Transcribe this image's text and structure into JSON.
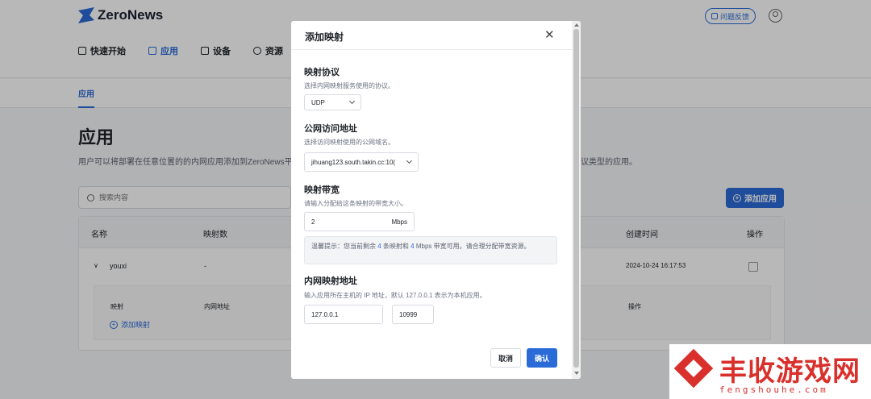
{
  "app": {
    "logo_text": "ZeroNews",
    "feedback_label": "问题反馈"
  },
  "nav": {
    "items": [
      {
        "label": "快速开始"
      },
      {
        "label": "应用"
      },
      {
        "label": "设备"
      },
      {
        "label": "资源"
      }
    ]
  },
  "subnav": {
    "tab": "应用"
  },
  "page": {
    "title": "应用",
    "description": "用户可以将部署在任意位置的的内网应用添加到ZeroNews平",
    "description_tail": "议类型的应用。",
    "search_placeholder": "搜索内容",
    "add_app_label": "添加应用"
  },
  "table": {
    "headers": {
      "name": "名称",
      "mappings": "映射数",
      "created": "创建时间",
      "actions": "操作"
    },
    "row": {
      "name": "youxi",
      "mappings": "-",
      "created": "2024-10-24 16:17:53"
    },
    "subtable": {
      "col_mapping": "映射",
      "col_inner": "内网地址",
      "col_actions": "操作",
      "add_mapping": "添加映射"
    }
  },
  "modal": {
    "title": "添加映射",
    "protocol": {
      "label": "映射协议",
      "help": "选择内网映射服务使用的协议。",
      "value": "UDP"
    },
    "public_address": {
      "label": "公网访问地址",
      "help": "选择访问映射使用的公网域名。",
      "value": "jihuang123.south.takin.cc:10("
    },
    "bandwidth": {
      "label": "映射带宽",
      "help": "请输入分配给这条映射的带宽大小。",
      "value": "2",
      "unit": "Mbps"
    },
    "tip": {
      "prefix": "温馨提示：您当前剩余",
      "remaining_mappings": "4",
      "middle": "条映射和",
      "remaining_bandwidth": "4",
      "suffix": "Mbps 带宽可用。请合理分配带宽资源。"
    },
    "inner_address": {
      "label": "内网映射地址",
      "help": "输入应用所在主机的 IP 地址，默认 127.0.0.1 表示为本机应用。",
      "ip": "127.0.0.1",
      "port": "10999"
    },
    "cancel_label": "取消",
    "confirm_label": "确认"
  },
  "watermark": {
    "text": "丰收游戏网",
    "sub": "fengshouhe.com"
  }
}
